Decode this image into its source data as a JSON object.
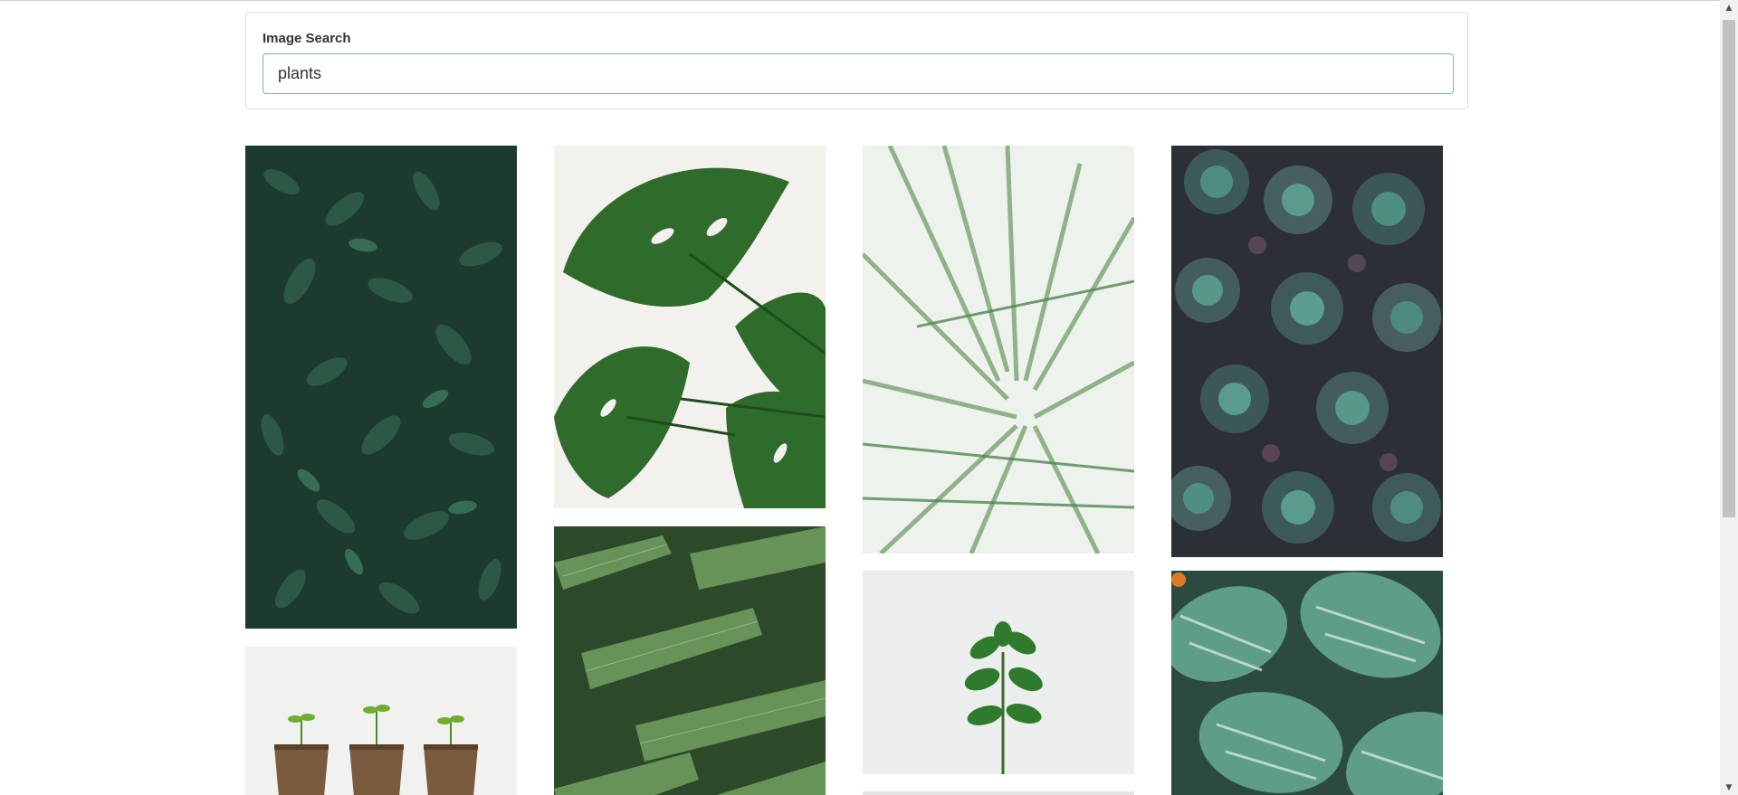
{
  "search": {
    "label": "Image Search",
    "value": "plants"
  },
  "results": [
    {
      "name": "green-leaves-dense"
    },
    {
      "name": "potted-seedlings"
    },
    {
      "name": "monstera-leaves"
    },
    {
      "name": "palm-fronds-dark"
    },
    {
      "name": "palm-leaves-bright"
    },
    {
      "name": "ficus-sprout"
    },
    {
      "name": "succulents-echeveria"
    },
    {
      "name": "calathea-striped-leaves"
    }
  ],
  "colors": {
    "input_border": "#80a7d8",
    "card_border": "#dddddd"
  }
}
